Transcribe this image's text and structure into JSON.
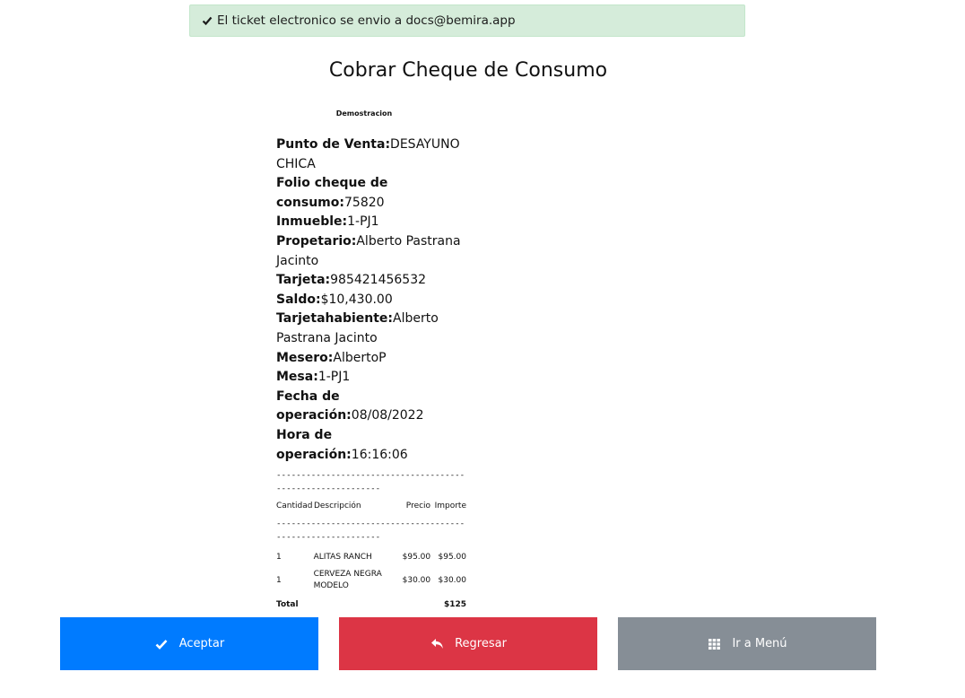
{
  "alert": {
    "message": "El ticket electronico se envio a docs@bemira.app",
    "icon": "check-icon",
    "color": "#d5ecda"
  },
  "page": {
    "title": "Cobrar Cheque de Consumo"
  },
  "ticket": {
    "company": "Demostracion",
    "fields": [
      {
        "label": "Punto de Venta:",
        "value": "DESAYUNO CHICA"
      },
      {
        "label": "Folio cheque de consumo:",
        "value": "75820"
      },
      {
        "label": "Inmueble:",
        "value": "1-PJ1"
      },
      {
        "label": "Propetario:",
        "value": "Alberto Pastrana Jacinto"
      },
      {
        "label": "Tarjeta:",
        "value": "985421456532"
      },
      {
        "label": "Saldo:",
        "value": "$10,430.00"
      },
      {
        "label": "Tarjetahabiente:",
        "value": "Alberto Pastrana Jacinto"
      },
      {
        "label": "Mesero:",
        "value": "AlbertoP"
      },
      {
        "label": "Mesa:",
        "value": "1-PJ1"
      },
      {
        "label": "Fecha de operación:",
        "value": "08/08/2022"
      },
      {
        "label": "Hora de operación:",
        "value": "16:16:06"
      }
    ],
    "separator": "-----------------------------------------------------------",
    "columns": {
      "qty": "Cantidad",
      "desc": "Descripción",
      "price": "Precio",
      "amount": "Importe"
    },
    "items": [
      {
        "qty": "1",
        "desc": "ALITAS RANCH",
        "price": "$95.00",
        "amount": "$95.00"
      },
      {
        "qty": "1",
        "desc": "CERVEZA NEGRA MODELO",
        "price": "$30.00",
        "amount": "$30.00"
      }
    ],
    "total_label": "Total",
    "total_value": "$125"
  },
  "buttons": {
    "accept": {
      "label": "Aceptar",
      "icon": "check-icon",
      "color": "#007bff"
    },
    "back": {
      "label": "Regresar",
      "icon": "reply-icon",
      "color": "#dc3545"
    },
    "menu": {
      "label": "Ir a Menú",
      "icon": "grid-icon",
      "color": "#868e96"
    }
  }
}
